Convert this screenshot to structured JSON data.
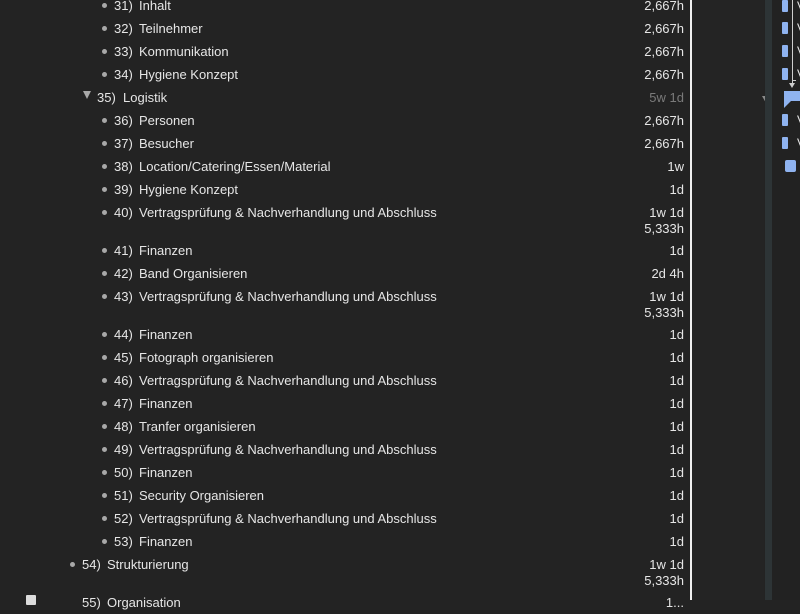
{
  "outline": {
    "rows": [
      {
        "num": "31)",
        "title": "Inhalt",
        "duration": [
          "2,667h"
        ],
        "level": 3
      },
      {
        "num": "32)",
        "title": "Teilnehmer",
        "duration": [
          "2,667h"
        ],
        "level": 3
      },
      {
        "num": "33)",
        "title": "Kommunikation",
        "duration": [
          "2,667h"
        ],
        "level": 3
      },
      {
        "num": "34)",
        "title": "Hygiene Konzept",
        "duration": [
          "2,667h"
        ],
        "level": 3
      },
      {
        "num": "35)",
        "title": "Logistik",
        "duration": [
          "5w 1d"
        ],
        "level": 2,
        "group": true
      },
      {
        "num": "36)",
        "title": "Personen",
        "duration": [
          "2,667h"
        ],
        "level": 3
      },
      {
        "num": "37)",
        "title": "Besucher",
        "duration": [
          "2,667h"
        ],
        "level": 3
      },
      {
        "num": "38)",
        "title": "Location/Catering/Essen/Material",
        "duration": [
          "1w"
        ],
        "level": 3
      },
      {
        "num": "39)",
        "title": "Hygiene Konzept",
        "duration": [
          "1d"
        ],
        "level": 3
      },
      {
        "num": "40)",
        "title": "Vertragsprüfung & Nachverhandlung und Abschluss",
        "duration": [
          "1w 1d",
          "5,333h"
        ],
        "level": 3
      },
      {
        "num": "41)",
        "title": "Finanzen",
        "duration": [
          "1d"
        ],
        "level": 3
      },
      {
        "num": "42)",
        "title": "Band Organisieren",
        "duration": [
          "2d 4h"
        ],
        "level": 3
      },
      {
        "num": "43)",
        "title": "Vertragsprüfung & Nachverhandlung und Abschluss",
        "duration": [
          "1w 1d",
          "5,333h"
        ],
        "level": 3
      },
      {
        "num": "44)",
        "title": "Finanzen",
        "duration": [
          "1d"
        ],
        "level": 3
      },
      {
        "num": "45)",
        "title": "Fotograph organisieren",
        "duration": [
          "1d"
        ],
        "level": 3
      },
      {
        "num": "46)",
        "title": "Vertragsprüfung & Nachverhandlung und Abschluss",
        "duration": [
          "1d"
        ],
        "level": 3
      },
      {
        "num": "47)",
        "title": "Finanzen",
        "duration": [
          "1d"
        ],
        "level": 3
      },
      {
        "num": "48)",
        "title": "Tranfer organisieren",
        "duration": [
          "1d"
        ],
        "level": 3
      },
      {
        "num": "49)",
        "title": "Vertragsprüfung & Nachverhandlung und Abschluss",
        "duration": [
          "1d"
        ],
        "level": 3
      },
      {
        "num": "50)",
        "title": "Finanzen",
        "duration": [
          "1d"
        ],
        "level": 3
      },
      {
        "num": "51)",
        "title": "Security Organisieren",
        "duration": [
          "1d"
        ],
        "level": 3
      },
      {
        "num": "52)",
        "title": "Vertragsprüfung & Nachverhandlung und Abschluss",
        "duration": [
          "1d"
        ],
        "level": 3
      },
      {
        "num": "53)",
        "title": "Finanzen",
        "duration": [
          "1d"
        ],
        "level": 3
      },
      {
        "num": "54)",
        "title": "Strukturierung",
        "duration": [
          "1w 1d",
          "5,333h"
        ],
        "level": 1
      },
      {
        "num": "55)",
        "title": "Organisation",
        "duration": [
          "1..."
        ],
        "level": 1,
        "partial": true
      }
    ]
  },
  "gantt": {
    "row_letters": [
      "V",
      "V",
      "V",
      "V",
      "",
      "V",
      "V"
    ],
    "bar_color": "#8fb3f0"
  }
}
